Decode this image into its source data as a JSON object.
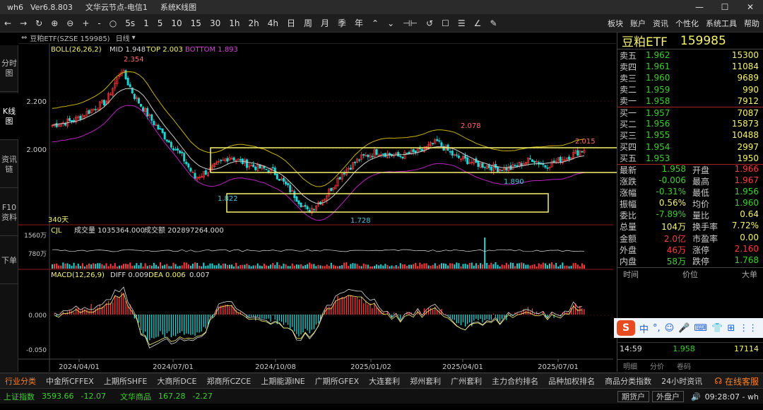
{
  "window": {
    "app": "wh6",
    "version": "Ver6.8.803",
    "node": "文华云节点-电信1",
    "section": "系统K线图",
    "min": "—",
    "max": "☐",
    "close": "✕"
  },
  "toolbar": {
    "items": [
      "←",
      "→",
      "↻",
      "⊕",
      "⊖",
      "+",
      "-",
      "○",
      "5s",
      "1",
      "5",
      "10",
      "15",
      "30",
      "1h",
      "2h",
      "4h",
      "日",
      "周",
      "月",
      "季",
      "年",
      "⌃",
      "⌄",
      "⊣⊢",
      "↺",
      "☐",
      "☰",
      "∠",
      "✎"
    ],
    "right": [
      "板块",
      "账户",
      "资讯",
      "个性化",
      "系统工具",
      "帮助"
    ]
  },
  "header": {
    "name": "豆粕ETF(SZSE 159985)",
    "period": "日线"
  },
  "left_tabs": [
    "分时图",
    "K线图",
    "资讯链",
    "F10资料",
    "下单"
  ],
  "boll": {
    "label": "BOLL(26,26,2)",
    "mid": "MID 1.948",
    "top": "TOP 2.003",
    "bottom": "BOTTOM 1.893"
  },
  "vol": {
    "label": "CJL",
    "vol": "成交量 1035364.000",
    "amt": "成交额 202897264.000",
    "tick_hi": "1560万",
    "tick_mid": "780万"
  },
  "macd": {
    "label": "MACD(12,26,9)",
    "diff": "DIFF 0.009",
    "dea": "DEA 0.006",
    "val": "0.007",
    "tick_hi": "0.000",
    "tick_lo": "-0.050"
  },
  "chart_data": {
    "type": "candlestick",
    "y_ticks": [
      "2.200",
      "2.000"
    ],
    "date_ticks": [
      "2024/04/01",
      "2024/07/01",
      "2024/10/08",
      "2025/01/02",
      "2025/04/01",
      "2025/07/01"
    ],
    "annotations": [
      "2.354",
      "1.822",
      "1.728",
      "2.078",
      "1.890",
      "2.015"
    ],
    "period_label": "340天"
  },
  "stock": {
    "name": "豆粕ETF",
    "code": "159985"
  },
  "orderbook": {
    "sell": [
      {
        "label": "卖五",
        "price": "1.962",
        "vol": "15300"
      },
      {
        "label": "卖四",
        "price": "1.961",
        "vol": "11084"
      },
      {
        "label": "卖三",
        "price": "1.960",
        "vol": "9689"
      },
      {
        "label": "卖二",
        "price": "1.959",
        "vol": "990"
      },
      {
        "label": "卖一",
        "price": "1.958",
        "vol": "7912"
      }
    ],
    "buy": [
      {
        "label": "买一",
        "price": "1.957",
        "vol": "7087"
      },
      {
        "label": "买二",
        "price": "1.956",
        "vol": "15873"
      },
      {
        "label": "买三",
        "price": "1.955",
        "vol": "10488"
      },
      {
        "label": "买四",
        "price": "1.954",
        "vol": "2997"
      },
      {
        "label": "买五",
        "price": "1.953",
        "vol": "1950"
      }
    ]
  },
  "stats": [
    {
      "k1": "最新",
      "v1": "1.958",
      "c1": "grn",
      "k2": "开盘",
      "v2": "1.966",
      "c2": "red"
    },
    {
      "k1": "涨跌",
      "v1": "-0.006",
      "c1": "grn",
      "k2": "最高",
      "v2": "1.967",
      "c2": "red"
    },
    {
      "k1": "涨幅",
      "v1": "-0.31%",
      "c1": "grn",
      "k2": "最低",
      "v2": "1.956",
      "c2": "grn"
    },
    {
      "k1": "振幅",
      "v1": "0.56%",
      "c1": "yel",
      "k2": "均价",
      "v2": "1.960",
      "c2": "grn"
    },
    {
      "k1": "委比",
      "v1": "-7.89%",
      "c1": "grn",
      "k2": "量比",
      "v2": "0.64",
      "c2": "yel"
    },
    {
      "k1": "总量",
      "v1": "104万",
      "c1": "yel",
      "k2": "换手率",
      "v2": "7.72%",
      "c2": "yel"
    },
    {
      "k1": "金额",
      "v1": "2.0亿",
      "c1": "red",
      "k2": "市盈率",
      "v2": "0.00",
      "c2": "yel"
    },
    {
      "k1": "外盘",
      "v1": "46万",
      "c1": "red",
      "k2": "涨停",
      "v2": "2.160",
      "c2": "red"
    },
    {
      "k1": "内盘",
      "v1": "58万",
      "c1": "grn",
      "k2": "跌停",
      "v2": "1.768",
      "c2": "grn"
    }
  ],
  "trades": {
    "hdr": [
      "时间",
      "价位",
      "大单"
    ],
    "ime": [
      "中",
      "°,",
      "☺",
      "🎤",
      "⌨",
      "👕",
      "⊞",
      "⋮⋮"
    ],
    "time": "14:59",
    "price": "1.958",
    "vol": "17114",
    "tabs": [
      "明细",
      "分价",
      "卷码"
    ]
  },
  "market_tabs": [
    "行业分类",
    "中金所CFFEX",
    "上期所SHFE",
    "大商所DCE",
    "郑商所CZCE",
    "上期能源INE",
    "广期所GFEX",
    "大连套利",
    "郑州套利",
    "广州套利",
    "主力合约排名",
    "品种加权排名",
    "商品分类指数",
    "24小时资讯"
  ],
  "service": "在线客服",
  "status": {
    "sh_label": "上证指数",
    "sh_val": "3593.66",
    "sh_chg": "-12.07",
    "wh_label": "文华商品",
    "wh_val": "167.28",
    "wh_chg": "-2.27",
    "b1": "期货户",
    "b2": "外盘户",
    "time": "09:28:07 - wh"
  }
}
